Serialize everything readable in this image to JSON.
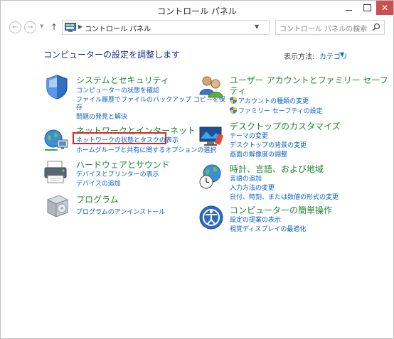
{
  "window": {
    "title": "コントロール パネル"
  },
  "navigation": {
    "address_text": "コントロール パネル",
    "search_placeholder": "コントロール パネルの検索"
  },
  "main": {
    "heading": "コンピューターの設定を調整します",
    "view_by_label": "表示方法:",
    "view_by_value": "カテゴリ"
  },
  "categories": [
    {
      "title": "システムとセキュリティ",
      "links": [
        "コンピューターの状態を確認",
        "ファイル履歴でファイルのバックアップ コピーを保",
        "存",
        "問題の発見と解決"
      ]
    },
    {
      "title": "ネットワークとインターネット",
      "links": [
        "ネットワークの状態とタスクの表示",
        "ホームグループと共有に関するオプションの選択"
      ]
    },
    {
      "title": "ハードウェアとサウンド",
      "links": [
        "デバイスとプリンターの表示",
        "デバイスの追加"
      ]
    },
    {
      "title": "プログラム",
      "links": [
        "プログラムのアンインストール"
      ]
    },
    {
      "title": "ユーザー アカウントとファミリー セーフ",
      "title_line2": "ティ",
      "links": [
        "アカウントの種類の変更",
        "ファミリー セーフティの設定"
      ]
    },
    {
      "title": "デスクトップのカスタマイズ",
      "links": [
        "テーマの変更",
        "デスクトップの背景の変更",
        "画面の解像度の調整"
      ]
    },
    {
      "title": "時計、言語、および地域",
      "links": [
        "言語の追加",
        "入力方法の変更",
        "日付、時刻、または数値の形式の変更"
      ]
    },
    {
      "title": "コンピューターの簡単操作",
      "links": [
        "設定の提案の表示",
        "視覚ディスプレイの最適化"
      ]
    }
  ],
  "colors": {
    "category_title": "#218533",
    "link": "#0b60c8",
    "heading": "#1e3287",
    "highlight_box": "#e02020"
  }
}
